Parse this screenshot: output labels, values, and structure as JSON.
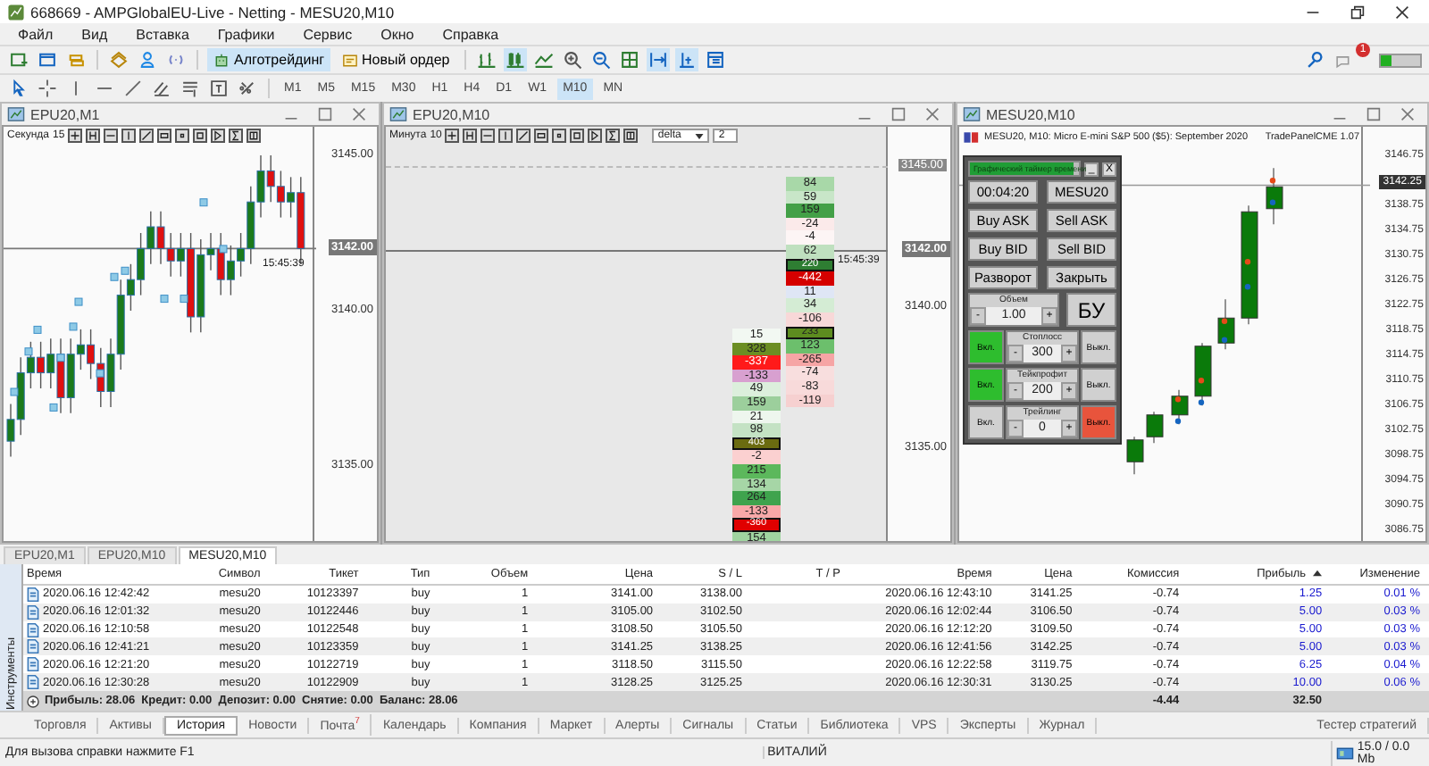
{
  "window": {
    "title": "668669 - AMPGlobalEU-Live - Netting - MESU20,M10"
  },
  "menu": [
    "Файл",
    "Вид",
    "Вставка",
    "Графики",
    "Сервис",
    "Окно",
    "Справка"
  ],
  "toolbar": {
    "buttons": [
      {
        "label": "Алготрейдинг",
        "selected": true
      },
      {
        "label": "Новый ордер",
        "selected": false
      }
    ],
    "notification_count": "1",
    "timeframes": [
      {
        "label": "M1",
        "selected": false
      },
      {
        "label": "M5",
        "selected": false
      },
      {
        "label": "M15",
        "selected": false
      },
      {
        "label": "M30",
        "selected": false
      },
      {
        "label": "H1",
        "selected": false
      },
      {
        "label": "H4",
        "selected": false
      },
      {
        "label": "D1",
        "selected": false
      },
      {
        "label": "W1",
        "selected": false
      },
      {
        "label": "M10",
        "selected": true
      },
      {
        "label": "MN",
        "selected": false
      }
    ]
  },
  "charts": [
    {
      "kind": "candles",
      "title": "EPU20,M1",
      "unit": "Секунда",
      "period": "15",
      "price_labels": [
        "3145.00",
        "3140.00",
        "3135.00"
      ],
      "current_price": "3142.00",
      "time": "15:45:39"
    },
    {
      "kind": "footprint",
      "title": "EPU20,M10",
      "unit": "Минута",
      "period": "10",
      "mode": "delta",
      "step": "2",
      "price_labels": [
        "3145.00",
        "3140.00",
        "3135.00"
      ],
      "current_price": "3142.00",
      "time": "15:45:39",
      "columns": [
        {
          "cells": [
            {
              "value": "84",
              "color": "#a8d8a8",
              "boxed": false
            },
            {
              "value": "59",
              "color": "#c8e6c8",
              "boxed": false
            },
            {
              "value": "159",
              "color": "#43a047",
              "boxed": false
            },
            {
              "value": "-24",
              "color": "#fbeaea",
              "boxed": false
            },
            {
              "value": "-4",
              "color": "#fdf5f5",
              "boxed": false
            },
            {
              "value": "62",
              "color": "#bfe0bf",
              "boxed": false
            },
            {
              "value": "220",
              "color": "#2e7d32",
              "boxed": true
            },
            {
              "value": "-442",
              "color": "#d50000",
              "boxed": false
            },
            {
              "value": "11",
              "color": "#dfe6f5",
              "boxed": false
            },
            {
              "value": "34",
              "color": "#d4ecd4",
              "boxed": false
            },
            {
              "value": "-106",
              "color": "#f8d8d8",
              "boxed": false
            },
            {
              "value": "233",
              "color": "#5d8c1f",
              "boxed": true
            },
            {
              "value": "123",
              "color": "#6cbf6c",
              "boxed": false
            },
            {
              "value": "-265",
              "color": "#f6a5a5",
              "boxed": false
            },
            {
              "value": "-74",
              "color": "#f8dede",
              "boxed": false
            },
            {
              "value": "-83",
              "color": "#f8dada",
              "boxed": false
            },
            {
              "value": "-119",
              "color": "#f6d0d0",
              "boxed": false
            }
          ]
        },
        {
          "cells": [
            {
              "value": "15",
              "color": "#f2f8f2",
              "boxed": false
            },
            {
              "value": "328",
              "color": "#6b8e23",
              "boxed": false
            },
            {
              "value": "-337",
              "color": "#ff1a1a",
              "boxed": false
            },
            {
              "value": "-133",
              "color": "#d8a0d0",
              "boxed": false
            },
            {
              "value": "49",
              "color": "#dcefdc",
              "boxed": false
            },
            {
              "value": "159",
              "color": "#9ccf9c",
              "boxed": false
            },
            {
              "value": "21",
              "color": "#eef6ee",
              "boxed": false
            },
            {
              "value": "98",
              "color": "#c4e2c4",
              "boxed": false
            },
            {
              "value": "403",
              "color": "#6b6b10",
              "boxed": true
            },
            {
              "value": "-2",
              "color": "#fbd0d0",
              "boxed": false
            },
            {
              "value": "215",
              "color": "#5cb85c",
              "boxed": false
            },
            {
              "value": "134",
              "color": "#a6d6a6",
              "boxed": false
            },
            {
              "value": "264",
              "color": "#3fa34d",
              "boxed": false
            },
            {
              "value": "-133",
              "color": "#f8a8a8",
              "boxed": false
            },
            {
              "value": "-360",
              "color": "#e00000",
              "boxed": true
            },
            {
              "value": "154",
              "color": "#a0d4a0",
              "boxed": false
            }
          ]
        }
      ]
    },
    {
      "kind": "trade_panel",
      "title": "MESU20,M10",
      "header": "MESU20, M10:  Micro E-mini S&P 500 ($5): September 2020",
      "indicator": "TradePanelCME 1.07",
      "price_labels": [
        "3146.75",
        "3138.75",
        "3134.75",
        "3130.75",
        "3126.75",
        "3122.75",
        "3118.75",
        "3114.75",
        "3110.75",
        "3106.75",
        "3102.75",
        "3098.75",
        "3094.75",
        "3090.75",
        "3086.75"
      ],
      "current_price": "3142.25",
      "panel": {
        "title": "Графический таймер времени",
        "level": 0.95,
        "minimize": "_",
        "close": "X",
        "timer": "00:04:20",
        "symbol": "MESU20",
        "actions": [
          "Buy ASK",
          "Sell ASK",
          "Buy BID",
          "Sell BID",
          "Разворот",
          "Закрыть"
        ],
        "volume": {
          "label": "Объем",
          "minus": "-",
          "value": "1.00",
          "plus": "+"
        },
        "breakeven": "БУ",
        "settings": [
          {
            "label": "Стоплосс",
            "value": "300",
            "on": true,
            "on_label": "Вкл.",
            "off_label": "Выкл.",
            "minus": "-",
            "plus": "+"
          },
          {
            "label": "Тейкпрофит",
            "value": "200",
            "on": true,
            "on_label": "Вкл.",
            "off_label": "Выкл.",
            "minus": "-",
            "plus": "+"
          },
          {
            "label": "Трейлинг",
            "value": "0",
            "on": false,
            "on_label": "Вкл.",
            "off_label": "Выкл.",
            "minus": "-",
            "plus": "+"
          }
        ]
      }
    }
  ],
  "chart_tabs": [
    {
      "label": "EPU20,M1",
      "selected": false
    },
    {
      "label": "EPU20,M10",
      "selected": false
    },
    {
      "label": "MESU20,M10",
      "selected": true
    }
  ],
  "side_label": "Инструменты",
  "trades": {
    "columns": [
      {
        "label": "Время",
        "sorted": false
      },
      {
        "label": "Символ",
        "sorted": false
      },
      {
        "label": "Тикет",
        "sorted": false
      },
      {
        "label": "Тип",
        "sorted": false
      },
      {
        "label": "Объем",
        "sorted": false
      },
      {
        "label": "Цена",
        "sorted": false
      },
      {
        "label": "S / L",
        "sorted": false
      },
      {
        "label": "T / P",
        "sorted": false
      },
      {
        "label": "Время",
        "sorted": false
      },
      {
        "label": "Цена",
        "sorted": false
      },
      {
        "label": "Комиссия",
        "sorted": false
      },
      {
        "label": "Прибыль",
        "sorted": true
      },
      {
        "label": "Изменение",
        "sorted": false
      }
    ],
    "rows": [
      [
        "2020.06.16 12:42:42",
        "mesu20",
        "10123397",
        "buy",
        "1",
        "3141.00",
        "3138.00",
        "",
        "2020.06.16 12:43:10",
        "3141.25",
        "-0.74",
        "1.25",
        "0.01 %"
      ],
      [
        "2020.06.16 12:01:32",
        "mesu20",
        "10122446",
        "buy",
        "1",
        "3105.00",
        "3102.50",
        "",
        "2020.06.16 12:02:44",
        "3106.50",
        "-0.74",
        "5.00",
        "0.03 %"
      ],
      [
        "2020.06.16 12:10:58",
        "mesu20",
        "10122548",
        "buy",
        "1",
        "3108.50",
        "3105.50",
        "",
        "2020.06.16 12:12:20",
        "3109.50",
        "-0.74",
        "5.00",
        "0.03 %"
      ],
      [
        "2020.06.16 12:41:21",
        "mesu20",
        "10123359",
        "buy",
        "1",
        "3141.25",
        "3138.25",
        "",
        "2020.06.16 12:41:56",
        "3142.25",
        "-0.74",
        "5.00",
        "0.03 %"
      ],
      [
        "2020.06.16 12:21:20",
        "mesu20",
        "10122719",
        "buy",
        "1",
        "3118.50",
        "3115.50",
        "",
        "2020.06.16 12:22:58",
        "3119.75",
        "-0.74",
        "6.25",
        "0.04 %"
      ],
      [
        "2020.06.16 12:30:28",
        "mesu20",
        "10122909",
        "buy",
        "1",
        "3128.25",
        "3125.25",
        "",
        "2020.06.16 12:30:31",
        "3130.25",
        "-0.74",
        "10.00",
        "0.06 %"
      ]
    ],
    "summary": {
      "text": "Прибыль: 28.06  Кредит: 0.00  Депозит: 0.00  Снятие: 0.00  Баланс: 28.06",
      "commission": "-4.44",
      "profit": "32.50"
    }
  },
  "bottom_tabs": [
    {
      "label": "Торговля",
      "selected": false
    },
    {
      "label": "Активы",
      "selected": false
    },
    {
      "label": "История",
      "selected": true
    },
    {
      "label": "Новости",
      "selected": false
    },
    {
      "label": "Почта",
      "badge": "7",
      "selected": false
    },
    {
      "label": "Календарь",
      "selected": false
    },
    {
      "label": "Компания",
      "selected": false
    },
    {
      "label": "Маркет",
      "selected": false
    },
    {
      "label": "Алерты",
      "selected": false
    },
    {
      "label": "Сигналы",
      "selected": false
    },
    {
      "label": "Статьи",
      "selected": false
    },
    {
      "label": "Библиотека",
      "selected": false
    },
    {
      "label": "VPS",
      "selected": false
    },
    {
      "label": "Эксперты",
      "selected": false
    },
    {
      "label": "Журнал",
      "selected": false
    }
  ],
  "strategy_tester": "Тестер стратегий",
  "status_bar": {
    "help": "Для вызова справки нажмите F1",
    "user": "ВИТАЛИЙ",
    "memory": "15.0 / 0.0 Mb"
  }
}
